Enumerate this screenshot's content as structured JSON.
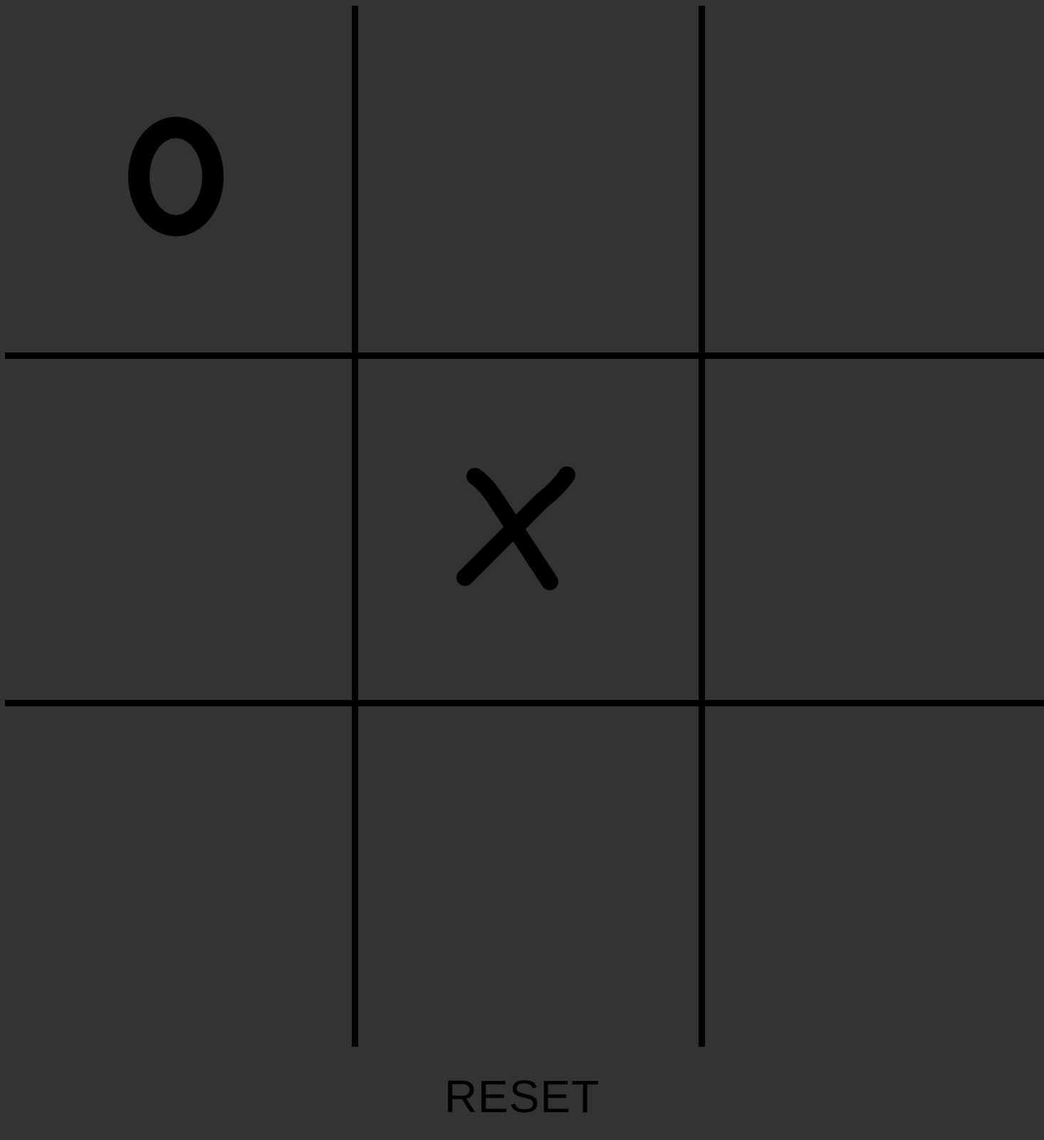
{
  "board": {
    "cells": [
      {
        "mark": "O"
      },
      {
        "mark": ""
      },
      {
        "mark": ""
      },
      {
        "mark": ""
      },
      {
        "mark": "X"
      },
      {
        "mark": ""
      },
      {
        "mark": ""
      },
      {
        "mark": ""
      },
      {
        "mark": ""
      }
    ]
  },
  "controls": {
    "reset_label": "RESET"
  },
  "colors": {
    "background": "#333333",
    "lines": "#000000",
    "marks": "#000000"
  }
}
